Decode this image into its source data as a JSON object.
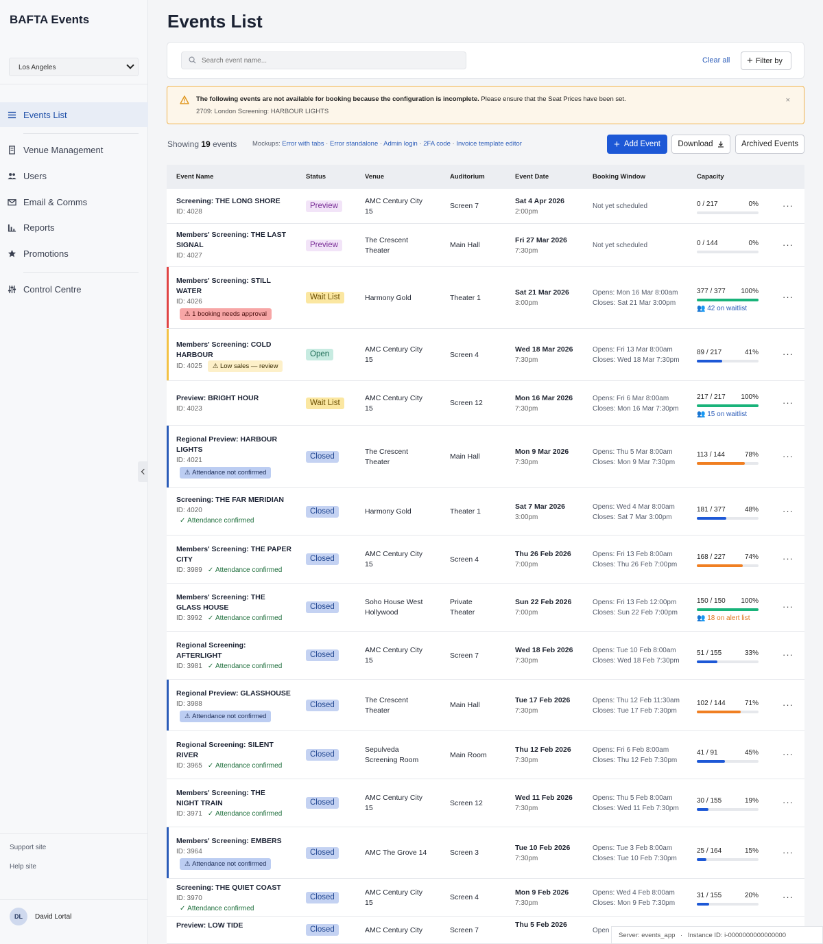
{
  "sidebar": {
    "brand": "BAFTA Events",
    "location": "Los Angeles",
    "nav": [
      {
        "label": "Events List",
        "icon": "list-icon"
      },
      {
        "label": "Venue Management",
        "icon": "building-icon"
      },
      {
        "label": "Users",
        "icon": "users-icon"
      },
      {
        "label": "Email & Comms",
        "icon": "mail-icon"
      },
      {
        "label": "Reports",
        "icon": "bar-chart-icon"
      },
      {
        "label": "Promotions",
        "icon": "star-icon"
      },
      {
        "label": "Control Centre",
        "icon": "sliders-icon"
      }
    ],
    "support": "Support site",
    "help": "Help site",
    "user_initials": "DL",
    "user_name": "David Lortal"
  },
  "main": {
    "title": "Events List",
    "search_placeholder": "Search event name...",
    "clear_all": "Clear all",
    "filter_by": "Filter by",
    "alert": {
      "bold": "The following events are not available for booking because the configuration is incomplete.",
      "rest": " Please ensure that the Seat Prices have been set.",
      "detail": "2709: London Screening: HARBOUR LIGHTS",
      "close": "×"
    },
    "showing_prefix": "Showing ",
    "showing_count": "19",
    "showing_suffix": " events",
    "mockups_label": "Mockups: ",
    "mockups": [
      "Error with tabs",
      "Error standalone",
      "Admin login",
      "2FA code",
      "Invoice template editor"
    ],
    "add_event": "Add Event",
    "download": "Download",
    "archived": "Archived Events"
  },
  "table": {
    "headers": [
      "Event Name",
      "Status",
      "Venue",
      "Auditorium",
      "Event Date",
      "Booking Window",
      "Capacity"
    ],
    "rows": [
      {
        "name": [
          "Screening: THE LONG SHORE"
        ],
        "id": "ID: 4028",
        "flag": null,
        "flagType": null,
        "confirmed": null,
        "status": "Preview",
        "st": "preview",
        "venue": [
          "AMC Century City",
          "15"
        ],
        "aud": [
          "Screen 7"
        ],
        "date": "Sat 4 Apr 2026",
        "time": "2:00pm",
        "bw": [
          "Not yet scheduled"
        ],
        "cap": "0 / 217",
        "pct": "0%",
        "fill": 0,
        "color": "#1d58d6",
        "note": null,
        "noteColor": null,
        "bar": null
      },
      {
        "name": [
          "Members' Screening: THE LAST",
          "SIGNAL"
        ],
        "id": "ID: 4027",
        "flag": null,
        "flagType": null,
        "confirmed": null,
        "status": "Preview",
        "st": "preview",
        "venue": [
          "The Crescent",
          "Theater"
        ],
        "aud": [
          "Main Hall"
        ],
        "date": "Fri 27 Mar 2026",
        "time": "7:30pm",
        "bw": [
          "Not yet scheduled"
        ],
        "cap": "0 / 144",
        "pct": "0%",
        "fill": 0,
        "color": "#1d58d6",
        "note": null,
        "noteColor": null,
        "bar": null
      },
      {
        "name": [
          "Members' Screening: STILL",
          "WATER"
        ],
        "id": "ID: 4026",
        "flag": "1 booking needs approval",
        "flagType": "red",
        "confirmed": null,
        "status": "Wait List",
        "st": "waitlist",
        "venue": [
          "Harmony Gold"
        ],
        "aud": [
          "Theater 1"
        ],
        "date": "Sat 21 Mar 2026",
        "time": "3:00pm",
        "bw": [
          "Opens: Mon 16 Mar 8:00am",
          "Closes: Sat 21 Mar 3:00pm"
        ],
        "cap": "377 / 377",
        "pct": "100%",
        "fill": 1,
        "color": "#19b37a",
        "note": "42 on waitlist",
        "noteColor": "#2a5bb8",
        "bar": "#e04444"
      },
      {
        "name": [
          "Members' Screening: COLD",
          "HARBOUR"
        ],
        "id": "ID: 4025",
        "flag": "Low sales — review",
        "flagType": "yellow",
        "confirmed": null,
        "status": "Open",
        "st": "open",
        "venue": [
          "AMC Century City",
          "15"
        ],
        "aud": [
          "Screen 4"
        ],
        "date": "Wed 18 Mar 2026",
        "time": "7:30pm",
        "bw": [
          "Opens: Fri 13 Mar 8:00am",
          "Closes: Wed 18 Mar 7:30pm"
        ],
        "cap": "89 / 217",
        "pct": "41%",
        "fill": 0.41,
        "color": "#1d58d6",
        "note": null,
        "noteColor": null,
        "bar": "#f3c244"
      },
      {
        "name": [
          "Preview: BRIGHT HOUR"
        ],
        "id": "ID: 4023",
        "flag": null,
        "flagType": null,
        "confirmed": null,
        "status": "Wait List",
        "st": "waitlist",
        "venue": [
          "AMC Century City",
          "15"
        ],
        "aud": [
          "Screen 12"
        ],
        "date": "Mon 16 Mar 2026",
        "time": "7:30pm",
        "bw": [
          "Opens: Fri 6 Mar 8:00am",
          "Closes: Mon 16 Mar 7:30pm"
        ],
        "cap": "217 / 217",
        "pct": "100%",
        "fill": 1,
        "color": "#19b37a",
        "note": "15 on waitlist",
        "noteColor": "#2a5bb8",
        "bar": null
      },
      {
        "name": [
          "Regional Preview: HARBOUR",
          "LIGHTS"
        ],
        "id": "ID: 4021",
        "flag": "Attendance not confirmed",
        "flagType": "blue",
        "confirmed": null,
        "status": "Closed",
        "st": "closed",
        "venue": [
          "The Crescent",
          "Theater"
        ],
        "aud": [
          "Main Hall"
        ],
        "date": "Mon 9 Mar 2026",
        "time": "7:30pm",
        "bw": [
          "Opens: Thu 5 Mar 8:00am",
          "Closes: Mon 9 Mar 7:30pm"
        ],
        "cap": "113 / 144",
        "pct": "78%",
        "fill": 0.78,
        "color": "#f07f22",
        "note": null,
        "noteColor": null,
        "bar": "#2a5bb8"
      },
      {
        "name": [
          "Screening: THE FAR MERIDIAN"
        ],
        "id": "ID: 4020",
        "flag": null,
        "flagType": null,
        "confirmed": "Attendance confirmed",
        "status": "Closed",
        "st": "closed",
        "venue": [
          "Harmony Gold"
        ],
        "aud": [
          "Theater 1"
        ],
        "date": "Sat 7 Mar 2026",
        "time": "3:00pm",
        "bw": [
          "Opens: Wed 4 Mar 8:00am",
          "Closes: Sat 7 Mar 3:00pm"
        ],
        "cap": "181 / 377",
        "pct": "48%",
        "fill": 0.48,
        "color": "#1d58d6",
        "note": null,
        "noteColor": null,
        "bar": null
      },
      {
        "name": [
          "Members' Screening: THE PAPER",
          "CITY"
        ],
        "id": "ID: 3989",
        "flag": null,
        "flagType": null,
        "confirmed": "Attendance confirmed",
        "status": "Closed",
        "st": "closed",
        "venue": [
          "AMC Century City",
          "15"
        ],
        "aud": [
          "Screen 4"
        ],
        "date": "Thu 26 Feb 2026",
        "time": "7:00pm",
        "bw": [
          "Opens: Fri 13 Feb 8:00am",
          "Closes: Thu 26 Feb 7:00pm"
        ],
        "cap": "168 / 227",
        "pct": "74%",
        "fill": 0.74,
        "color": "#f07f22",
        "note": null,
        "noteColor": null,
        "bar": null
      },
      {
        "name": [
          "Members' Screening: THE",
          "GLASS HOUSE"
        ],
        "id": "ID: 3992",
        "flag": null,
        "flagType": null,
        "confirmed": "Attendance confirmed",
        "status": "Closed",
        "st": "closed",
        "venue": [
          "Soho House West",
          "Hollywood"
        ],
        "aud": [
          "Private",
          "Theater"
        ],
        "date": "Sun 22 Feb 2026",
        "time": "7:00pm",
        "bw": [
          "Opens: Fri 13 Feb 12:00pm",
          "Closes: Sun 22 Feb 7:00pm"
        ],
        "cap": "150 / 150",
        "pct": "100%",
        "fill": 1,
        "color": "#19b37a",
        "note": "18 on alert list",
        "noteColor": "#e0761d",
        "bar": null
      },
      {
        "name": [
          "Regional Screening:",
          "AFTERLIGHT"
        ],
        "id": "ID: 3981",
        "flag": null,
        "flagType": null,
        "confirmed": "Attendance confirmed",
        "status": "Closed",
        "st": "closed",
        "venue": [
          "AMC Century City",
          "15"
        ],
        "aud": [
          "Screen 7"
        ],
        "date": "Wed 18 Feb 2026",
        "time": "7:30pm",
        "bw": [
          "Opens: Tue 10 Feb 8:00am",
          "Closes: Wed 18 Feb 7:30pm"
        ],
        "cap": "51 / 155",
        "pct": "33%",
        "fill": 0.33,
        "color": "#1d58d6",
        "note": null,
        "noteColor": null,
        "bar": null
      },
      {
        "name": [
          "Regional Preview: GLASSHOUSE"
        ],
        "id": "ID: 3988",
        "flag": "Attendance not confirmed",
        "flagType": "blue",
        "confirmed": null,
        "status": "Closed",
        "st": "closed",
        "venue": [
          "The Crescent",
          "Theater"
        ],
        "aud": [
          "Main Hall"
        ],
        "date": "Tue 17 Feb 2026",
        "time": "7:30pm",
        "bw": [
          "Opens: Thu 12 Feb 11:30am",
          "Closes: Tue 17 Feb 7:30pm"
        ],
        "cap": "102 / 144",
        "pct": "71%",
        "fill": 0.71,
        "color": "#f07f22",
        "note": null,
        "noteColor": null,
        "bar": "#2a5bb8"
      },
      {
        "name": [
          "Regional Screening: SILENT",
          "RIVER"
        ],
        "id": "ID: 3965",
        "flag": null,
        "flagType": null,
        "confirmed": "Attendance confirmed",
        "status": "Closed",
        "st": "closed",
        "venue": [
          "Sepulveda",
          "Screening Room"
        ],
        "aud": [
          "Main Room"
        ],
        "date": "Thu 12 Feb 2026",
        "time": "7:30pm",
        "bw": [
          "Opens: Fri 6 Feb 8:00am",
          "Closes: Thu 12 Feb 7:30pm"
        ],
        "cap": "41 / 91",
        "pct": "45%",
        "fill": 0.45,
        "color": "#1d58d6",
        "note": null,
        "noteColor": null,
        "bar": null
      },
      {
        "name": [
          "Members' Screening: THE",
          "NIGHT TRAIN"
        ],
        "id": "ID: 3971",
        "flag": null,
        "flagType": null,
        "confirmed": "Attendance confirmed",
        "status": "Closed",
        "st": "closed",
        "venue": [
          "AMC Century City",
          "15"
        ],
        "aud": [
          "Screen 12"
        ],
        "date": "Wed 11 Feb 2026",
        "time": "7:30pm",
        "bw": [
          "Opens: Thu 5 Feb 8:00am",
          "Closes: Wed 11 Feb 7:30pm"
        ],
        "cap": "30 / 155",
        "pct": "19%",
        "fill": 0.19,
        "color": "#1d58d6",
        "note": null,
        "noteColor": null,
        "bar": null
      },
      {
        "name": [
          "Members' Screening: EMBERS"
        ],
        "id": "ID: 3964",
        "flag": "Attendance not confirmed",
        "flagType": "blue",
        "confirmed": null,
        "status": "Closed",
        "st": "closed",
        "venue": [
          "AMC The Grove 14"
        ],
        "aud": [
          "Screen 3"
        ],
        "date": "Tue 10 Feb 2026",
        "time": "7:30pm",
        "bw": [
          "Opens: Tue 3 Feb 8:00am",
          "Closes: Tue 10 Feb 7:30pm"
        ],
        "cap": "25 / 164",
        "pct": "15%",
        "fill": 0.15,
        "color": "#1d58d6",
        "note": null,
        "noteColor": null,
        "bar": "#2a5bb8"
      },
      {
        "name": [
          "Screening: THE QUIET COAST"
        ],
        "id": "ID: 3970",
        "flag": null,
        "flagType": null,
        "confirmed": "Attendance confirmed",
        "status": "Closed",
        "st": "closed",
        "venue": [
          "AMC Century City",
          "15"
        ],
        "aud": [
          "Screen 4"
        ],
        "date": "Mon 9 Feb 2026",
        "time": "7:30pm",
        "bw": [
          "Opens: Wed 4 Feb 8:00am",
          "Closes: Mon 9 Feb 7:30pm"
        ],
        "cap": "31 / 155",
        "pct": "20%",
        "fill": 0.2,
        "color": "#1d58d6",
        "note": null,
        "noteColor": null,
        "bar": null
      },
      {
        "name": [
          "Preview: LOW TIDE"
        ],
        "id": "",
        "flag": null,
        "flagType": null,
        "confirmed": null,
        "status": "Closed",
        "st": "closed",
        "venue": [
          "AMC Century City"
        ],
        "aud": [
          "Screen 7"
        ],
        "date": "Thu 5 Feb 2026",
        "time": "",
        "bw": [
          "Open"
        ],
        "cap": "",
        "pct": "",
        "fill": 0,
        "color": "#1d58d6",
        "note": null,
        "noteColor": null,
        "bar": null
      }
    ],
    "row_action": "···"
  },
  "footer": {
    "server": "Server: events_app",
    "sep": "·",
    "instance": "Instance ID: i-0000000000000000"
  }
}
